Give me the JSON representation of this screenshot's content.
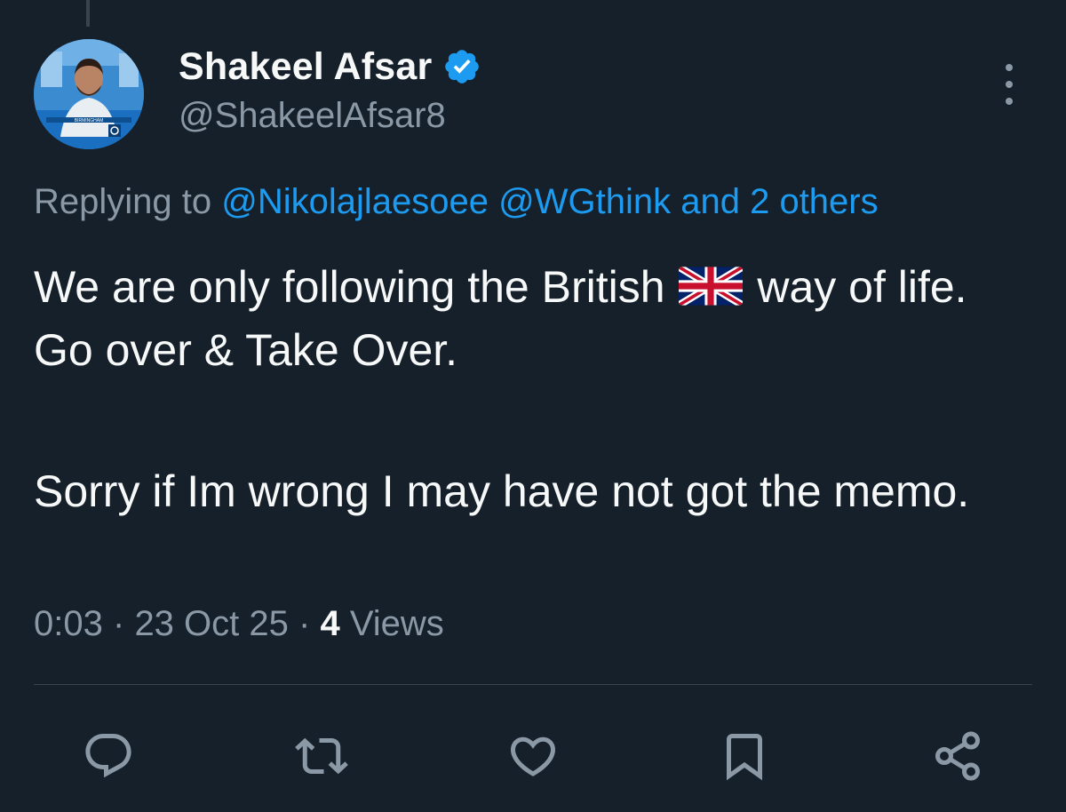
{
  "tweet": {
    "author": {
      "display_name": "Shakeel Afsar",
      "handle": "@ShakeelAfsar8",
      "verified": true,
      "avatar_caption": "BIRMINGHAM"
    },
    "reply": {
      "prefix": "Replying to",
      "mentions": [
        "@Nikolajlaesoee",
        "@WGthink"
      ],
      "others": "and 2 others"
    },
    "text": {
      "line1_before_flag": "We are only following the British",
      "flag_icon": "uk-flag-emoji",
      "line1_after_flag": "way of life. Go over & Take Over.",
      "paragraph2": "Sorry if Im wrong I may have not got the memo."
    },
    "meta": {
      "time": "0:03",
      "separator": "·",
      "date": "23 Oct 25",
      "views_count": "4",
      "views_label": "Views"
    },
    "actions": [
      {
        "name": "reply",
        "icon": "speech-bubble-icon"
      },
      {
        "name": "retweet",
        "icon": "retweet-icon"
      },
      {
        "name": "like",
        "icon": "heart-icon"
      },
      {
        "name": "bookmark",
        "icon": "bookmark-icon"
      },
      {
        "name": "share",
        "icon": "share-icon"
      }
    ]
  },
  "colors": {
    "background": "#15202b",
    "text_primary": "#f7f9f9",
    "text_secondary": "#8b98a5",
    "link": "#1d9bf0",
    "divider": "#38444d"
  }
}
